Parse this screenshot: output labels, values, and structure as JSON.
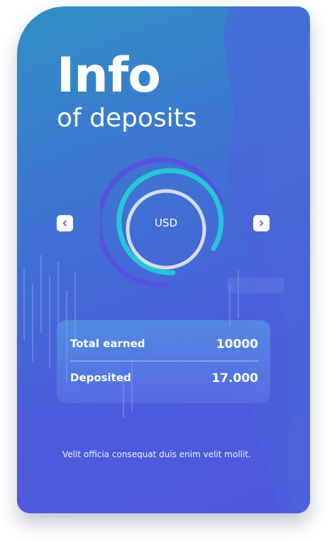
{
  "header": {
    "title": "Info",
    "subtitle": "of deposits"
  },
  "gauge": {
    "currency": "USD"
  },
  "stats": {
    "rows": [
      {
        "label": "Total earned",
        "value": "10000"
      },
      {
        "label": "Deposited",
        "value": "17.000"
      }
    ]
  },
  "footer": {
    "text": "Velit officia consequat duis enim velit mollit."
  },
  "icons": {
    "prev": "chevron-left-icon",
    "next": "chevron-right-icon"
  },
  "colors": {
    "accent_teal": "#25c6d6",
    "accent_indigo": "#5a4fe0",
    "nav_arrow": "#4f58dd"
  }
}
